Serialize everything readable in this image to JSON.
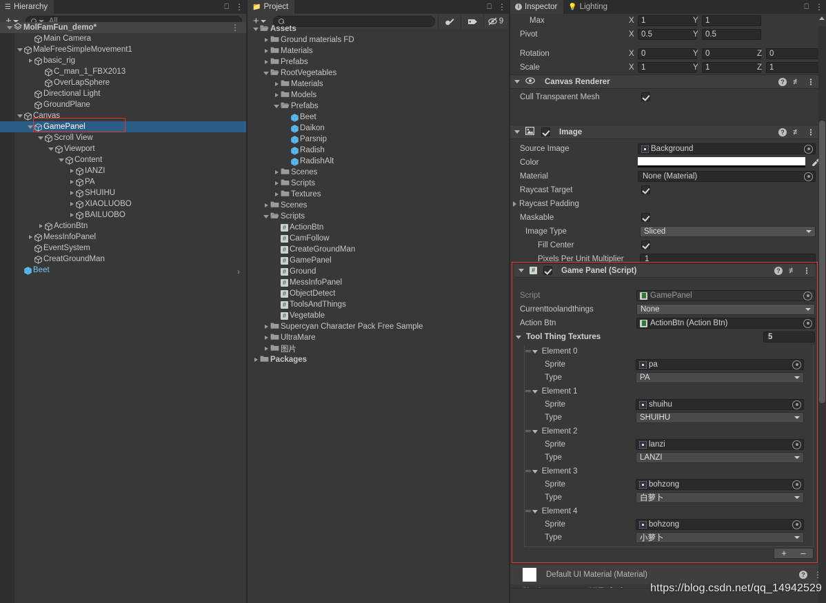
{
  "app": {
    "watermark": "https://blog.csdn.net/qq_14942529"
  },
  "hierarchy": {
    "tab_label": "Hierarchy",
    "create_label": "+",
    "search_placeholder": "All",
    "scene_name": "MolFamFun_demo*",
    "items": [
      {
        "label": "MolFamFun_demo*",
        "depth": 0,
        "icon": "scene-icon",
        "arrow": "open",
        "selected": false,
        "scene": true
      },
      {
        "label": "Main Camera",
        "depth": 2,
        "icon": "cube-icon",
        "arrow": "none",
        "selected": false
      },
      {
        "label": "MaleFreeSimpleMovement1",
        "depth": 1,
        "icon": "cube-icon",
        "arrow": "open",
        "selected": false
      },
      {
        "label": "basic_rig",
        "depth": 2,
        "icon": "cube-icon",
        "arrow": "closed",
        "selected": false
      },
      {
        "label": "C_man_1_FBX2013",
        "depth": 3,
        "icon": "cube-icon",
        "arrow": "none",
        "selected": false
      },
      {
        "label": "OverLapSphere",
        "depth": 3,
        "icon": "cube-icon",
        "arrow": "none",
        "selected": false
      },
      {
        "label": "Directional Light",
        "depth": 2,
        "icon": "cube-icon",
        "arrow": "none",
        "selected": false
      },
      {
        "label": "GroundPlane",
        "depth": 2,
        "icon": "cube-icon",
        "arrow": "none",
        "selected": false
      },
      {
        "label": "Canvas",
        "depth": 1,
        "icon": "cube-icon",
        "arrow": "open",
        "selected": false
      },
      {
        "label": "GamePanel",
        "depth": 2,
        "icon": "cube-icon",
        "arrow": "open",
        "selected": true
      },
      {
        "label": "Scroll View",
        "depth": 3,
        "icon": "cube-icon",
        "arrow": "open",
        "selected": false
      },
      {
        "label": "Viewport",
        "depth": 4,
        "icon": "cube-icon",
        "arrow": "open",
        "selected": false
      },
      {
        "label": "Content",
        "depth": 5,
        "icon": "cube-icon",
        "arrow": "open",
        "selected": false
      },
      {
        "label": "IANZI",
        "depth": 6,
        "icon": "cube-icon",
        "arrow": "closed",
        "selected": false
      },
      {
        "label": "PA",
        "depth": 6,
        "icon": "cube-icon",
        "arrow": "closed",
        "selected": false
      },
      {
        "label": "SHUIHU",
        "depth": 6,
        "icon": "cube-icon",
        "arrow": "closed",
        "selected": false
      },
      {
        "label": "XIAOLUOBO",
        "depth": 6,
        "icon": "cube-icon",
        "arrow": "closed",
        "selected": false
      },
      {
        "label": "BAILUOBO",
        "depth": 6,
        "icon": "cube-icon",
        "arrow": "closed",
        "selected": false
      },
      {
        "label": "ActionBtn",
        "depth": 3,
        "icon": "cube-icon",
        "arrow": "closed",
        "selected": false
      },
      {
        "label": "MessInfoPanel",
        "depth": 2,
        "icon": "cube-icon",
        "arrow": "closed",
        "selected": false
      },
      {
        "label": "EventSystem",
        "depth": 2,
        "icon": "cube-icon",
        "arrow": "none",
        "selected": false
      },
      {
        "label": "CreatGroundMan",
        "depth": 2,
        "icon": "cube-icon",
        "arrow": "none",
        "selected": false
      },
      {
        "label": "Beet",
        "depth": 1,
        "icon": "prefab-icon",
        "arrow": "none",
        "selected": false,
        "prefab": true
      }
    ]
  },
  "project": {
    "tab_label": "Project",
    "create_label": "+",
    "search_placeholder": "",
    "hidden_count": "9",
    "items": [
      {
        "label": "Assets",
        "depth": 0,
        "icon": "folder-open-icon",
        "arrow": "open",
        "bold": true
      },
      {
        "label": "Ground materials FD",
        "depth": 1,
        "icon": "folder-icon",
        "arrow": "closed"
      },
      {
        "label": "Materials",
        "depth": 1,
        "icon": "folder-icon",
        "arrow": "closed"
      },
      {
        "label": "Prefabs",
        "depth": 1,
        "icon": "folder-icon",
        "arrow": "closed"
      },
      {
        "label": "RootVegetables",
        "depth": 1,
        "icon": "folder-open-icon",
        "arrow": "open"
      },
      {
        "label": "Materials",
        "depth": 2,
        "icon": "folder-icon",
        "arrow": "closed"
      },
      {
        "label": "Models",
        "depth": 2,
        "icon": "folder-icon",
        "arrow": "closed"
      },
      {
        "label": "Prefabs",
        "depth": 2,
        "icon": "folder-open-icon",
        "arrow": "open"
      },
      {
        "label": "Beet",
        "depth": 3,
        "icon": "prefab-icon",
        "arrow": "none"
      },
      {
        "label": "Daikon",
        "depth": 3,
        "icon": "prefab-icon",
        "arrow": "none"
      },
      {
        "label": "Parsnip",
        "depth": 3,
        "icon": "prefab-icon",
        "arrow": "none"
      },
      {
        "label": "Radish",
        "depth": 3,
        "icon": "prefab-icon",
        "arrow": "none"
      },
      {
        "label": "RadishAlt",
        "depth": 3,
        "icon": "prefab-icon",
        "arrow": "none"
      },
      {
        "label": "Scenes",
        "depth": 2,
        "icon": "folder-icon",
        "arrow": "closed"
      },
      {
        "label": "Scripts",
        "depth": 2,
        "icon": "folder-icon",
        "arrow": "closed"
      },
      {
        "label": "Textures",
        "depth": 2,
        "icon": "folder-icon",
        "arrow": "closed"
      },
      {
        "label": "Scenes",
        "depth": 1,
        "icon": "folder-icon",
        "arrow": "closed"
      },
      {
        "label": "Scripts",
        "depth": 1,
        "icon": "folder-open-icon",
        "arrow": "open"
      },
      {
        "label": "ActionBtn",
        "depth": 2,
        "icon": "script-icon",
        "arrow": "none"
      },
      {
        "label": "CamFollow",
        "depth": 2,
        "icon": "script-icon",
        "arrow": "none"
      },
      {
        "label": "CreateGroundMan",
        "depth": 2,
        "icon": "script-icon",
        "arrow": "none"
      },
      {
        "label": "GamePanel",
        "depth": 2,
        "icon": "script-icon",
        "arrow": "none"
      },
      {
        "label": "Ground",
        "depth": 2,
        "icon": "script-icon",
        "arrow": "none"
      },
      {
        "label": "MessInfoPanel",
        "depth": 2,
        "icon": "script-icon",
        "arrow": "none"
      },
      {
        "label": "ObjectDetect",
        "depth": 2,
        "icon": "script-icon",
        "arrow": "none"
      },
      {
        "label": "ToolsAndThings",
        "depth": 2,
        "icon": "script-icon",
        "arrow": "none"
      },
      {
        "label": "Vegetable",
        "depth": 2,
        "icon": "script-icon",
        "arrow": "none"
      },
      {
        "label": "Supercyan Character Pack Free Sample",
        "depth": 1,
        "icon": "folder-icon",
        "arrow": "closed"
      },
      {
        "label": "UltraMare",
        "depth": 1,
        "icon": "folder-icon",
        "arrow": "closed"
      },
      {
        "label": "图片",
        "depth": 1,
        "icon": "folder-icon",
        "arrow": "closed"
      },
      {
        "label": "Packages",
        "depth": 0,
        "icon": "folder-icon",
        "arrow": "closed",
        "bold": true
      }
    ]
  },
  "inspector": {
    "tab_label": "Inspector",
    "lighting_tab_label": "Lighting",
    "rect_transform": {
      "rows": [
        {
          "label": "Max",
          "fields": [
            {
              "axis": "X",
              "value": "1"
            },
            {
              "axis": "Y",
              "value": "1"
            }
          ]
        },
        {
          "label": "Pivot",
          "fields": [
            {
              "axis": "X",
              "value": "0.5"
            },
            {
              "axis": "Y",
              "value": "0.5"
            }
          ]
        },
        {
          "label": "Rotation",
          "fields": [
            {
              "axis": "X",
              "value": "0"
            },
            {
              "axis": "Y",
              "value": "0"
            },
            {
              "axis": "Z",
              "value": "0"
            }
          ]
        },
        {
          "label": "Scale",
          "fields": [
            {
              "axis": "X",
              "value": "1"
            },
            {
              "axis": "Y",
              "value": "1"
            },
            {
              "axis": "Z",
              "value": "1"
            }
          ]
        }
      ]
    },
    "canvas_renderer": {
      "title": "Canvas Renderer",
      "cull_label": "Cull Transparent Mesh",
      "cull_checked": true
    },
    "image": {
      "title": "Image",
      "enabled": true,
      "source_image_label": "Source Image",
      "source_image_value": "Background",
      "color_label": "Color",
      "color_value": "#FFFFFF",
      "material_label": "Material",
      "material_value": "None (Material)",
      "raycast_target_label": "Raycast Target",
      "raycast_target_checked": true,
      "raycast_padding_label": "Raycast Padding",
      "maskable_label": "Maskable",
      "maskable_checked": true,
      "image_type_label": "Image Type",
      "image_type_value": "Sliced",
      "fill_center_label": "Fill Center",
      "fill_center_checked": true,
      "ppu_label": "Pixels Per Unit Multiplier",
      "ppu_value": "1"
    },
    "game_panel": {
      "title": "Game Panel (Script)",
      "enabled": true,
      "script_label": "Script",
      "script_value": "GamePanel",
      "current_label": "Currenttoolandthings",
      "current_value": "None",
      "action_btn_label": "Action Btn",
      "action_btn_value": "ActionBtn (Action Btn)",
      "array_label": "Tool Thing Textures",
      "array_size": "5",
      "sprite_label": "Sprite",
      "type_label": "Type",
      "elements": [
        {
          "name": "Element 0",
          "sprite": "pa",
          "type": "PA"
        },
        {
          "name": "Element 1",
          "sprite": "shuihu",
          "type": "SHUIHU"
        },
        {
          "name": "Element 2",
          "sprite": "lanzi",
          "type": "LANZI"
        },
        {
          "name": "Element 3",
          "sprite": "bohzong",
          "type": "白萝卜"
        },
        {
          "name": "Element 4",
          "sprite": "bohzong",
          "type": "小萝卜"
        }
      ],
      "add_label": "+",
      "remove_label": "–"
    },
    "material": {
      "title": "Default UI Material (Material)",
      "shader_label": "Shader",
      "shader_value": "UI/Default",
      "edit_label": "Edit..."
    }
  },
  "colors": {
    "selection_blue": "#2c5d87",
    "highlight_red": "#e8352c",
    "panel_bg": "#383838",
    "header_bg": "#3f3f3f",
    "prefab_blue": "#7ec5f0"
  }
}
